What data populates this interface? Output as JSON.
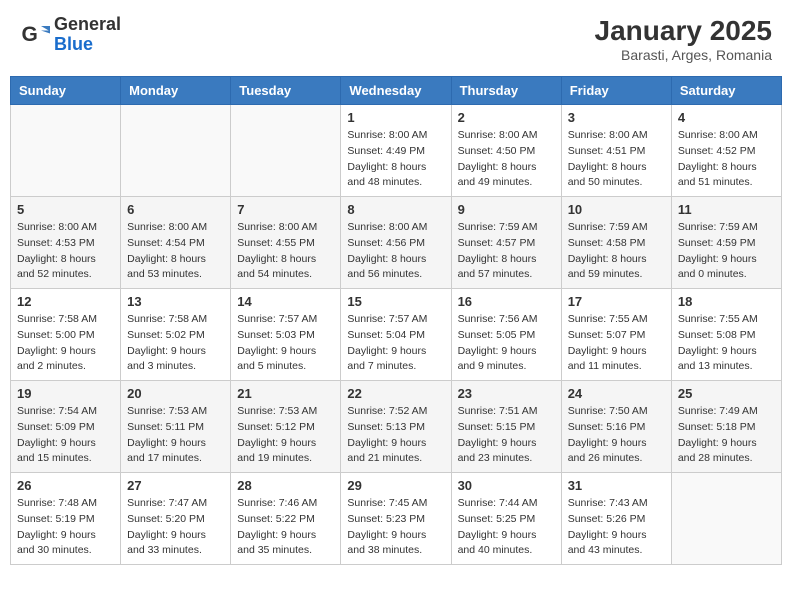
{
  "header": {
    "logo_general": "General",
    "logo_blue": "Blue",
    "month_year": "January 2025",
    "location": "Barasti, Arges, Romania"
  },
  "days_of_week": [
    "Sunday",
    "Monday",
    "Tuesday",
    "Wednesday",
    "Thursday",
    "Friday",
    "Saturday"
  ],
  "weeks": [
    [
      {
        "day": "",
        "empty": true
      },
      {
        "day": "",
        "empty": true
      },
      {
        "day": "",
        "empty": true
      },
      {
        "day": "1",
        "sunrise": "8:00 AM",
        "sunset": "4:49 PM",
        "daylight": "8 hours and 48 minutes."
      },
      {
        "day": "2",
        "sunrise": "8:00 AM",
        "sunset": "4:50 PM",
        "daylight": "8 hours and 49 minutes."
      },
      {
        "day": "3",
        "sunrise": "8:00 AM",
        "sunset": "4:51 PM",
        "daylight": "8 hours and 50 minutes."
      },
      {
        "day": "4",
        "sunrise": "8:00 AM",
        "sunset": "4:52 PM",
        "daylight": "8 hours and 51 minutes."
      }
    ],
    [
      {
        "day": "5",
        "sunrise": "8:00 AM",
        "sunset": "4:53 PM",
        "daylight": "8 hours and 52 minutes."
      },
      {
        "day": "6",
        "sunrise": "8:00 AM",
        "sunset": "4:54 PM",
        "daylight": "8 hours and 53 minutes."
      },
      {
        "day": "7",
        "sunrise": "8:00 AM",
        "sunset": "4:55 PM",
        "daylight": "8 hours and 54 minutes."
      },
      {
        "day": "8",
        "sunrise": "8:00 AM",
        "sunset": "4:56 PM",
        "daylight": "8 hours and 56 minutes."
      },
      {
        "day": "9",
        "sunrise": "7:59 AM",
        "sunset": "4:57 PM",
        "daylight": "8 hours and 57 minutes."
      },
      {
        "day": "10",
        "sunrise": "7:59 AM",
        "sunset": "4:58 PM",
        "daylight": "8 hours and 59 minutes."
      },
      {
        "day": "11",
        "sunrise": "7:59 AM",
        "sunset": "4:59 PM",
        "daylight": "9 hours and 0 minutes."
      }
    ],
    [
      {
        "day": "12",
        "sunrise": "7:58 AM",
        "sunset": "5:00 PM",
        "daylight": "9 hours and 2 minutes."
      },
      {
        "day": "13",
        "sunrise": "7:58 AM",
        "sunset": "5:02 PM",
        "daylight": "9 hours and 3 minutes."
      },
      {
        "day": "14",
        "sunrise": "7:57 AM",
        "sunset": "5:03 PM",
        "daylight": "9 hours and 5 minutes."
      },
      {
        "day": "15",
        "sunrise": "7:57 AM",
        "sunset": "5:04 PM",
        "daylight": "9 hours and 7 minutes."
      },
      {
        "day": "16",
        "sunrise": "7:56 AM",
        "sunset": "5:05 PM",
        "daylight": "9 hours and 9 minutes."
      },
      {
        "day": "17",
        "sunrise": "7:55 AM",
        "sunset": "5:07 PM",
        "daylight": "9 hours and 11 minutes."
      },
      {
        "day": "18",
        "sunrise": "7:55 AM",
        "sunset": "5:08 PM",
        "daylight": "9 hours and 13 minutes."
      }
    ],
    [
      {
        "day": "19",
        "sunrise": "7:54 AM",
        "sunset": "5:09 PM",
        "daylight": "9 hours and 15 minutes."
      },
      {
        "day": "20",
        "sunrise": "7:53 AM",
        "sunset": "5:11 PM",
        "daylight": "9 hours and 17 minutes."
      },
      {
        "day": "21",
        "sunrise": "7:53 AM",
        "sunset": "5:12 PM",
        "daylight": "9 hours and 19 minutes."
      },
      {
        "day": "22",
        "sunrise": "7:52 AM",
        "sunset": "5:13 PM",
        "daylight": "9 hours and 21 minutes."
      },
      {
        "day": "23",
        "sunrise": "7:51 AM",
        "sunset": "5:15 PM",
        "daylight": "9 hours and 23 minutes."
      },
      {
        "day": "24",
        "sunrise": "7:50 AM",
        "sunset": "5:16 PM",
        "daylight": "9 hours and 26 minutes."
      },
      {
        "day": "25",
        "sunrise": "7:49 AM",
        "sunset": "5:18 PM",
        "daylight": "9 hours and 28 minutes."
      }
    ],
    [
      {
        "day": "26",
        "sunrise": "7:48 AM",
        "sunset": "5:19 PM",
        "daylight": "9 hours and 30 minutes."
      },
      {
        "day": "27",
        "sunrise": "7:47 AM",
        "sunset": "5:20 PM",
        "daylight": "9 hours and 33 minutes."
      },
      {
        "day": "28",
        "sunrise": "7:46 AM",
        "sunset": "5:22 PM",
        "daylight": "9 hours and 35 minutes."
      },
      {
        "day": "29",
        "sunrise": "7:45 AM",
        "sunset": "5:23 PM",
        "daylight": "9 hours and 38 minutes."
      },
      {
        "day": "30",
        "sunrise": "7:44 AM",
        "sunset": "5:25 PM",
        "daylight": "9 hours and 40 minutes."
      },
      {
        "day": "31",
        "sunrise": "7:43 AM",
        "sunset": "5:26 PM",
        "daylight": "9 hours and 43 minutes."
      },
      {
        "day": "",
        "empty": true
      }
    ]
  ],
  "labels": {
    "sunrise": "Sunrise:",
    "sunset": "Sunset:",
    "daylight": "Daylight:"
  }
}
